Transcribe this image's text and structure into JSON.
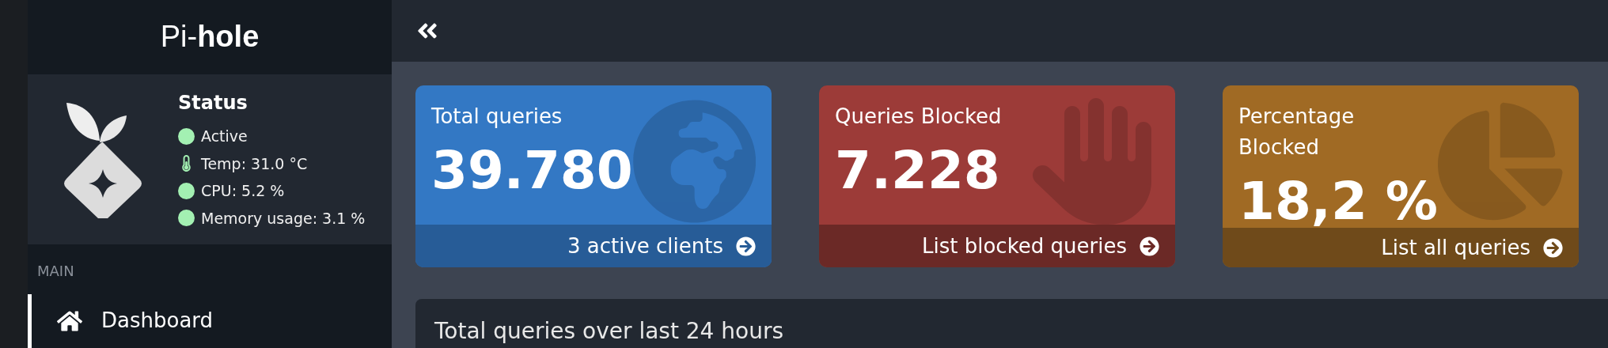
{
  "sidebar": {
    "logo": "Pi-**hole**",
    "status": {
      "title": "Status",
      "items": [
        {
          "kind": "dot",
          "text": "Active",
          "color": "#a3f0b2"
        },
        {
          "kind": "thermometer",
          "text": "Temp: 31.0 °C",
          "color": "#a3f0b2"
        },
        {
          "kind": "dot",
          "text": "CPU: 5.2 %",
          "color": "#a3f0b2"
        },
        {
          "kind": "dot",
          "text": "Memory usage: 3.1 %",
          "color": "#a3f0b2"
        }
      ]
    },
    "section": "MAIN",
    "items": [
      {
        "label": "Dashboard",
        "selected": true
      }
    ]
  },
  "cards": [
    {
      "kind": "globe",
      "title": "Total queries",
      "value": "39.780",
      "footer": "3 active clients",
      "color": "#3378c4"
    },
    {
      "kind": "hand",
      "title": "Queries Blocked",
      "value": "7.228",
      "footer": "List blocked queries",
      "color": "#9c3b38"
    },
    {
      "kind": "pie",
      "title": "Percentage Blocked",
      "value": "18,2 %",
      "footer": "List all queries",
      "color": "#a06a24"
    }
  ],
  "panel": {
    "title": "Total queries over last 24 hours"
  }
}
